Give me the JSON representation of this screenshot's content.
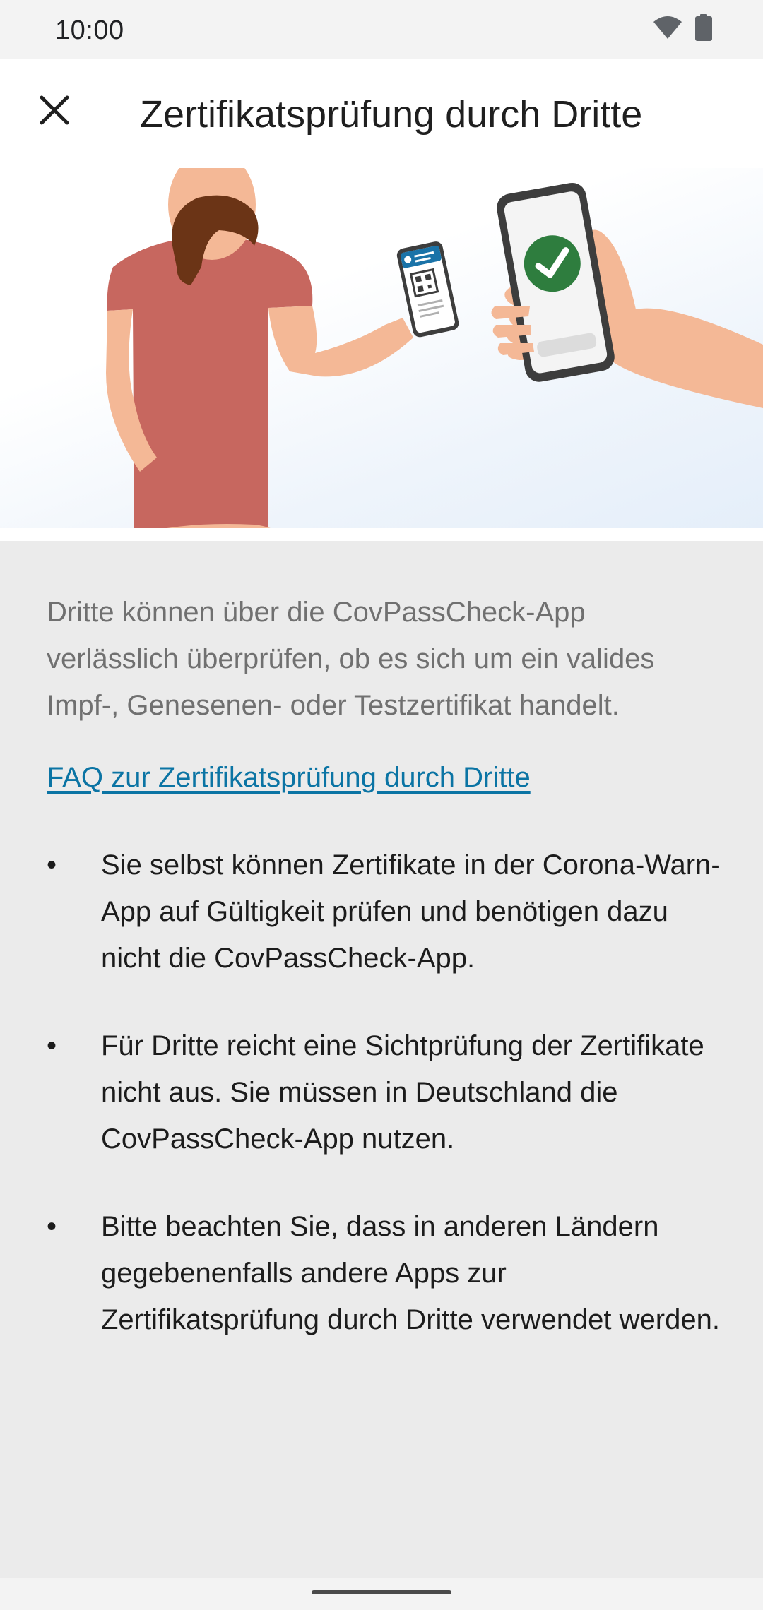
{
  "status_bar": {
    "time": "10:00",
    "icons": [
      "wifi-icon",
      "battery-icon"
    ]
  },
  "app_bar": {
    "close_icon": "close-icon",
    "title": "Zertifikatsprüfung durch Dritte"
  },
  "illustration": {
    "subject": "person-showing-qr-certificate-to-checker-phone",
    "check_icon": "checkmark-icon"
  },
  "content": {
    "intro": "Dritte können über die CovPassCheck-App verlässlich überprüfen, ob es sich um ein valides Impf-, Genesenen- oder Testzertifikat handelt.",
    "faq_link": "FAQ zur Zertifikatsprüfung durch Dritte",
    "bullets": [
      "Sie selbst können Zertifikate in der Corona-Warn-App auf Gültigkeit prüfen und benötigen dazu nicht die CovPassCheck-App.",
      "Für Dritte reicht eine Sichtprüfung der Zertifikate nicht aus. Sie müssen in Deutschland die CovPassCheck-App nutzen.",
      "Bitte beachten Sie, dass in anderen Ländern gegebenenfalls andere Apps zur Zertifikatsprüfung durch Dritte verwendet werden."
    ],
    "bullet_symbol": "•"
  },
  "colors": {
    "link": "#0b74a4",
    "shirt": "#c7675f",
    "skin": "#f4b896",
    "hair": "#6b3416",
    "check_green": "#2e7d3e",
    "phone_frame": "#3d3d3d",
    "certificate_blue": "#1a73a8"
  }
}
